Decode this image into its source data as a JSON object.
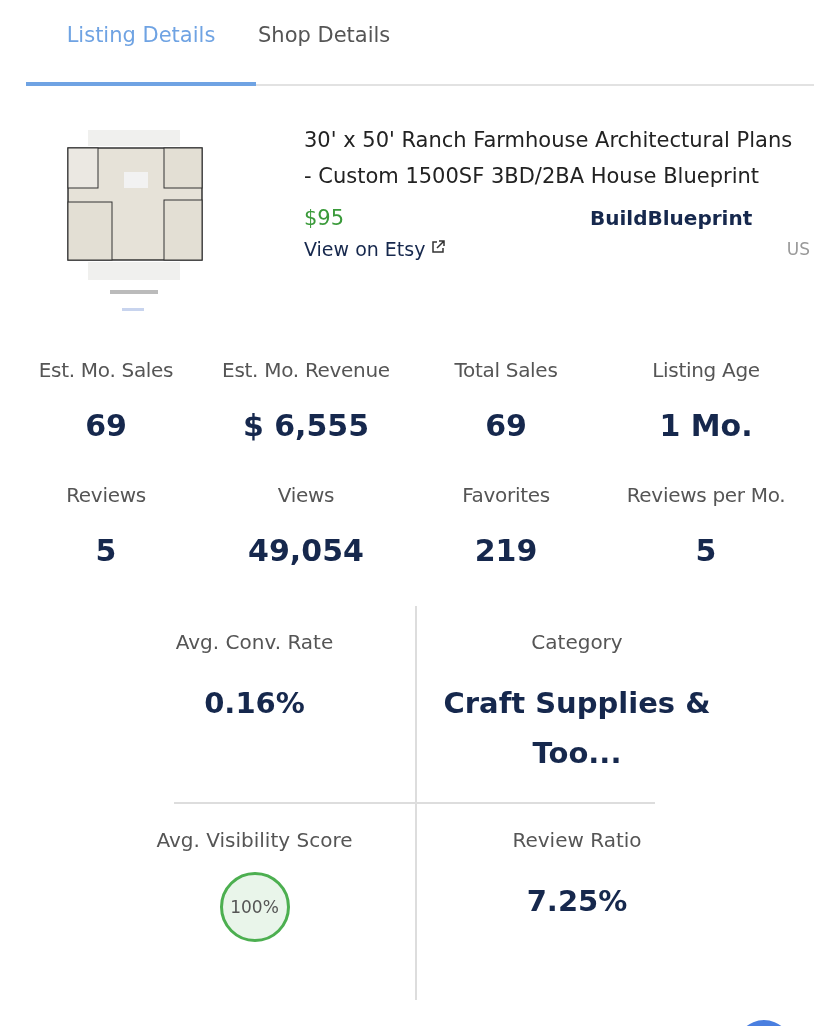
{
  "tabs": [
    {
      "label": "Listing Details",
      "selected": true
    },
    {
      "label": "Shop Details",
      "selected": false
    }
  ],
  "listing": {
    "title": "30' x 50' Ranch Farmhouse Architectural Plans - Custom 1500SF 3BD/2BA House Blueprint",
    "price": "$95",
    "shop": "BuildBlueprint",
    "link": "View on Etsy",
    "country": "US"
  },
  "stats": [
    {
      "label": "Est. Mo. Sales",
      "value": "69"
    },
    {
      "label": "Est. Mo. Revenue",
      "value": "$ 6,555"
    },
    {
      "label": "Total Sales",
      "value": "69"
    },
    {
      "label": "Listing Age",
      "value": "1 Mo."
    },
    {
      "label": "Reviews",
      "value": "5"
    },
    {
      "label": "Views",
      "value": "49,054"
    },
    {
      "label": "Favorites",
      "value": "219"
    },
    {
      "label": "Reviews per Mo.",
      "value": "5"
    }
  ],
  "metrics": [
    {
      "kind": "text",
      "label": "Avg. Conv. Rate",
      "value": "0.16%"
    },
    {
      "kind": "text",
      "label": "Category",
      "value": "Craft Supplies & Too..."
    },
    {
      "kind": "score",
      "label": "Avg. Visibility Score",
      "value": "100%",
      "color": "#4caf50"
    },
    {
      "kind": "text",
      "label": "Review Ratio",
      "value": "7.25%"
    }
  ]
}
